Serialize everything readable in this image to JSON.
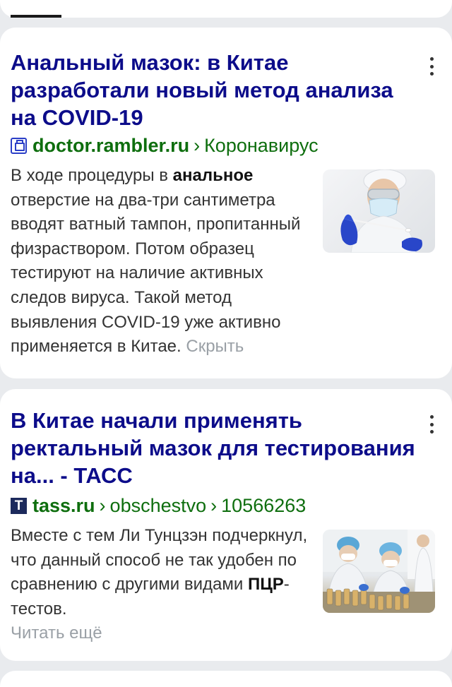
{
  "results": [
    {
      "title": "Анальный мазок: в Китае разработали новый метод анализа на COVID-19",
      "favicon": "hospital-icon",
      "domain": "doctor.rambler.ru",
      "breadcrumbs": [
        "Коронавирус"
      ],
      "snippet_before": "В ходе процедуры в ",
      "snippet_bold": "анальное",
      "snippet_after": " отверстие на два-три сантиметра вводят ватный тампон, пропитанный физраствором. Потом образец тестируют на наличие активных следов вируса. Такой метод выявления COVID-19 уже активно применяется в Китае.",
      "toggle_label": "Скрыть",
      "thumbnail": "doctor-with-swab-image"
    },
    {
      "title": "В Китае начали применять ректальный мазок для тестирования на... - ТАСС",
      "favicon_letter": "T",
      "domain": "tass.ru",
      "breadcrumbs": [
        "obschestvo",
        "10566263"
      ],
      "snippet_before": "Вместе с тем Ли Тунцзэн подчеркнул, что данный способ не так удобен по сравнению с другими видами ",
      "snippet_bold": "ПЦР",
      "snippet_after": "-тестов.",
      "toggle_label": "Читать ещё",
      "thumbnail": "lab-workers-image"
    }
  ],
  "colors": {
    "title": "#0c0c8a",
    "url": "#0e6e0e",
    "muted_link": "#9aa0a6",
    "background": "#e9ebee"
  }
}
